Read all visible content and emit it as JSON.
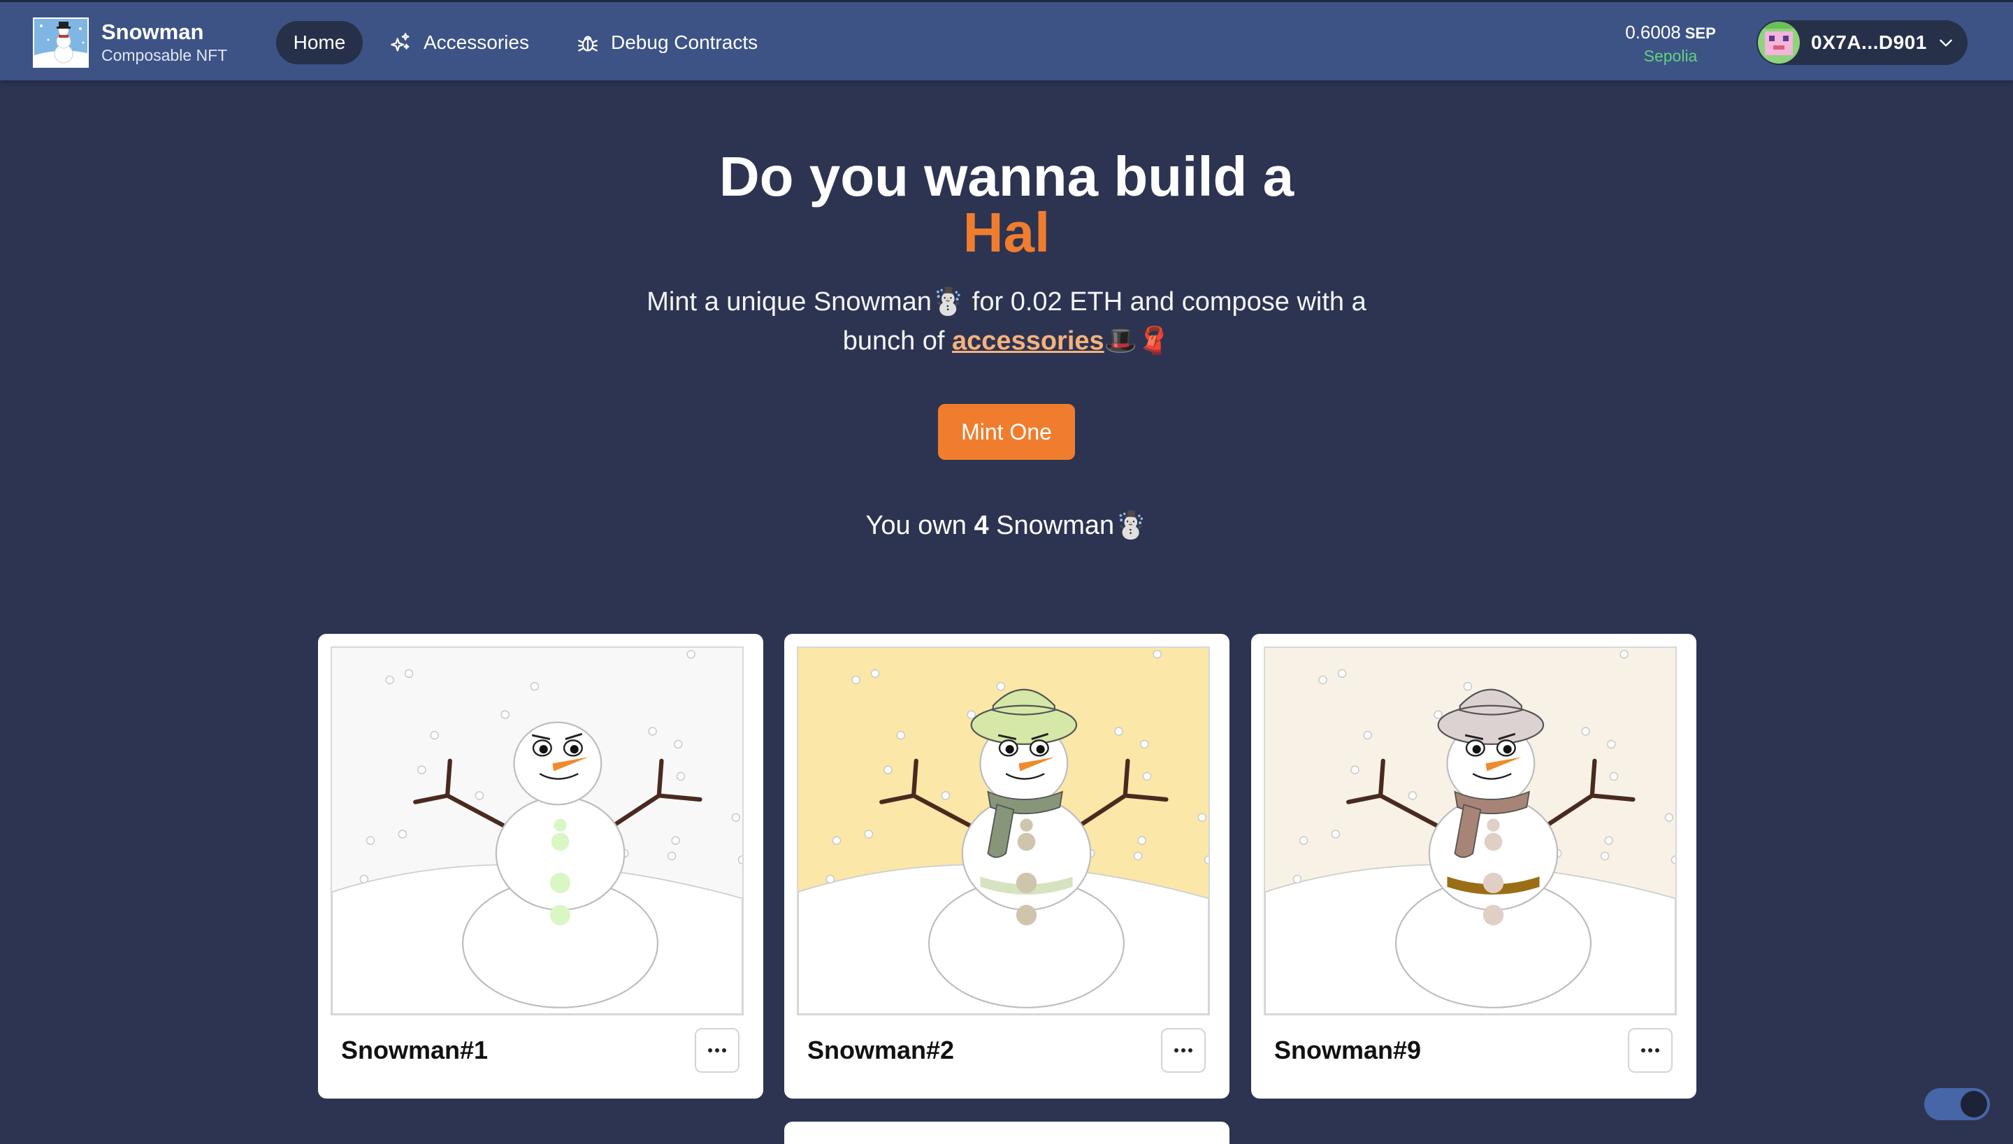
{
  "brand": {
    "title": "Snowman",
    "subtitle": "Composable NFT"
  },
  "nav": {
    "home": "Home",
    "accessories": "Accessories",
    "debug": "Debug Contracts"
  },
  "balance": {
    "value": "0.6008",
    "unit": "SEP",
    "network": "Sepolia"
  },
  "wallet": {
    "address": "0X7A...D901"
  },
  "hero": {
    "line1": "Do you wanna build a",
    "line2": "Hal",
    "desc_before": "Mint a unique Snowman☃️ for 0.02 ETH and compose with a bunch of ",
    "desc_link": "accessories",
    "desc_after": "🎩🧣",
    "mint_label": "Mint One",
    "own_before": "You own ",
    "own_count": "4",
    "own_after": " Snowman☃️"
  },
  "cards": [
    {
      "name": "Snowman#1",
      "background": "#f8f8f8",
      "button_color": "#d9f7c4",
      "hat": null,
      "scarf": null,
      "belt": null
    },
    {
      "name": "Snowman#2",
      "background": "#fbe7a8",
      "button_color": "#cfc5ad",
      "hat": "#d5e8a7",
      "scarf": "#879679",
      "belt": "#d5e3c1"
    },
    {
      "name": "Snowman#9",
      "background": "#f8f1e6",
      "button_color": "#e0cfc5",
      "hat": "#ddd2d2",
      "scarf": "#a88477",
      "belt": "#9a6e16"
    }
  ],
  "colors": {
    "page_bg": "#2d3451",
    "navbar_bg": "#3d5385",
    "accent": "#f07d2e",
    "network": "#5fd37d"
  },
  "icons": {
    "accessories": "sparkles-icon",
    "debug": "bug-icon",
    "wallet_menu": "chevron-down-icon",
    "card_menu": "ellipsis-icon"
  }
}
